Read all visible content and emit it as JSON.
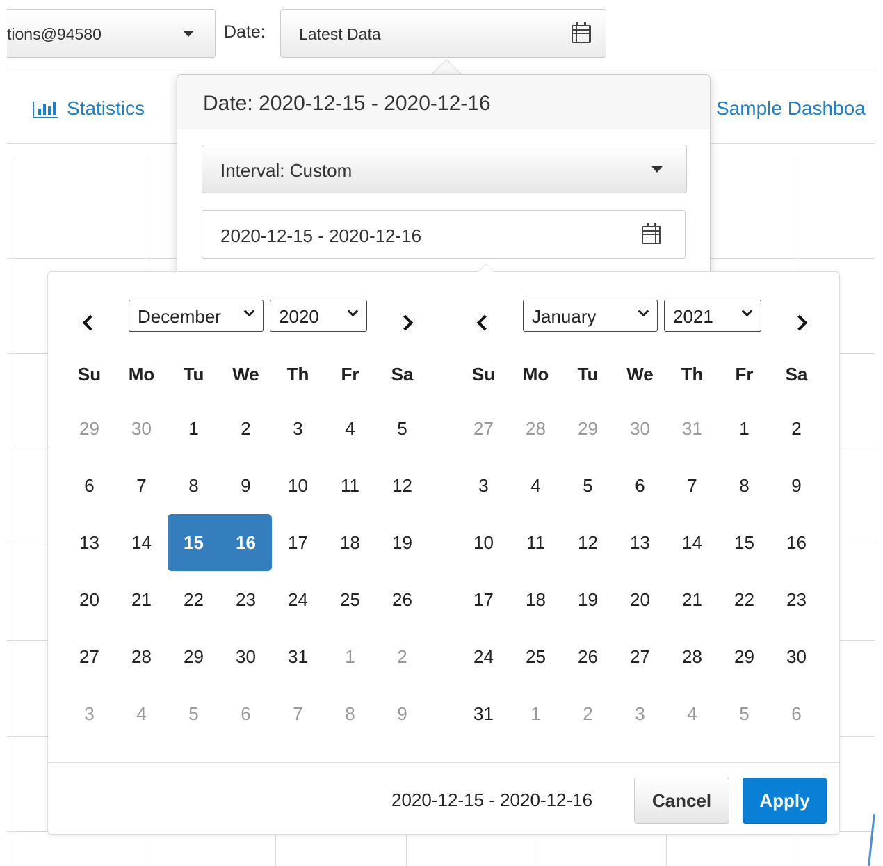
{
  "toolbar": {
    "source_select_value": "tions@94580",
    "date_label": "Date:",
    "date_button_value": "Latest Data"
  },
  "nav": {
    "statistics": "Statistics",
    "sample_dashboard": "Sample Dashboa"
  },
  "popover": {
    "header": "Date: 2020-12-15 - 2020-12-16",
    "interval_select": "Interval: Custom",
    "range_input_value": "2020-12-15 - 2020-12-16"
  },
  "calendar": {
    "weekdays": [
      "Su",
      "Mo",
      "Tu",
      "We",
      "Th",
      "Fr",
      "Sa"
    ],
    "left": {
      "month": "December",
      "year": "2020",
      "weeks": [
        [
          "29",
          "30",
          "1",
          "2",
          "3",
          "4",
          "5"
        ],
        [
          "6",
          "7",
          "8",
          "9",
          "10",
          "11",
          "12"
        ],
        [
          "13",
          "14",
          "15",
          "16",
          "17",
          "18",
          "19"
        ],
        [
          "20",
          "21",
          "22",
          "23",
          "24",
          "25",
          "26"
        ],
        [
          "27",
          "28",
          "29",
          "30",
          "31",
          "1",
          "2"
        ],
        [
          "3",
          "4",
          "5",
          "6",
          "7",
          "8",
          "9"
        ]
      ]
    },
    "right": {
      "month": "January",
      "year": "2021",
      "weeks": [
        [
          "27",
          "28",
          "29",
          "30",
          "31",
          "1",
          "2"
        ],
        [
          "3",
          "4",
          "5",
          "6",
          "7",
          "8",
          "9"
        ],
        [
          "10",
          "11",
          "12",
          "13",
          "14",
          "15",
          "16"
        ],
        [
          "17",
          "18",
          "19",
          "20",
          "21",
          "22",
          "23"
        ],
        [
          "24",
          "25",
          "26",
          "27",
          "28",
          "29",
          "30"
        ],
        [
          "31",
          "1",
          "2",
          "3",
          "4",
          "5",
          "6"
        ]
      ]
    },
    "selected_range": "2020-12-15 - 2020-12-16",
    "cancel_label": "Cancel",
    "apply_label": "Apply"
  },
  "colors": {
    "accent": "#357ebd",
    "apply": "#0a7fd6",
    "link": "#1b7fcc"
  }
}
